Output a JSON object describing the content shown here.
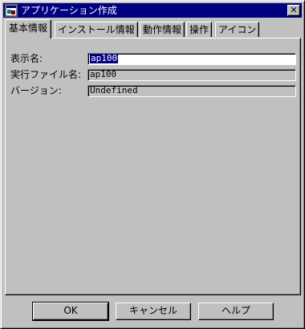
{
  "window": {
    "title": "アプリケーション作成",
    "close_glyph": "✕",
    "app_icon": "app-window-icon",
    "title_bar_color": "#000080"
  },
  "tabs": [
    {
      "label": "基本情報",
      "active": true
    },
    {
      "label": "インストール情報",
      "active": false
    },
    {
      "label": "動作情報",
      "active": false
    },
    {
      "label": "操作",
      "active": false
    },
    {
      "label": "アイコン",
      "active": false
    }
  ],
  "fields": {
    "display_name": {
      "label": "表示名:",
      "value": "ap100",
      "selected": true
    },
    "exec_file": {
      "label": "実行ファイル名:",
      "value": "ap100"
    },
    "version": {
      "label": "バージョン:",
      "value": "Undefined"
    }
  },
  "buttons": {
    "ok": "OK",
    "cancel": "キャンセル",
    "help": "ヘルプ"
  }
}
